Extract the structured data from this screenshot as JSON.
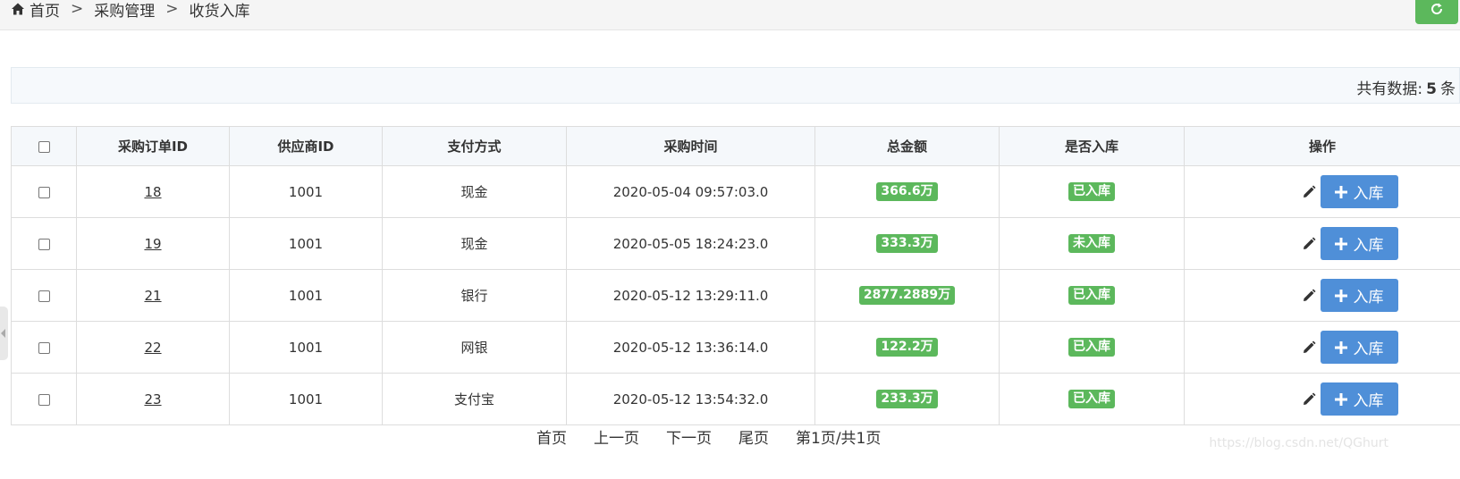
{
  "breadcrumb": {
    "icon": "home-icon",
    "items": [
      "首页",
      "采购管理",
      "收货入库"
    ],
    "separator": ">"
  },
  "toolbar": {
    "refresh_icon": "refresh-icon",
    "refresh_color": "#5cb85c"
  },
  "summary": {
    "label": "共有数据:",
    "count": "5",
    "unit": "条"
  },
  "table": {
    "headers": [
      "采购订单ID",
      "供应商ID",
      "支付方式",
      "采购时间",
      "总金额",
      "是否入库",
      "操作"
    ],
    "rows": [
      {
        "id": "18",
        "supplier": "1001",
        "payment": "现金",
        "time": "2020-05-04 09:57:03.0",
        "amount": "366.6万",
        "status": "已入库",
        "action": "入库"
      },
      {
        "id": "19",
        "supplier": "1001",
        "payment": "现金",
        "time": "2020-05-05 18:24:23.0",
        "amount": "333.3万",
        "status": "未入库",
        "action": "入库"
      },
      {
        "id": "21",
        "supplier": "1001",
        "payment": "银行",
        "time": "2020-05-12 13:29:11.0",
        "amount": "2877.2889万",
        "status": "已入库",
        "action": "入库"
      },
      {
        "id": "22",
        "supplier": "1001",
        "payment": "网银",
        "time": "2020-05-12 13:36:14.0",
        "amount": "122.2万",
        "status": "已入库",
        "action": "入库"
      },
      {
        "id": "23",
        "supplier": "1001",
        "payment": "支付宝",
        "time": "2020-05-12 13:54:32.0",
        "amount": "233.3万",
        "status": "已入库",
        "action": "入库"
      }
    ]
  },
  "pager": {
    "first": "首页",
    "prev": "上一页",
    "next": "下一页",
    "last": "尾页",
    "info": "第1页/共1页"
  },
  "watermark": "https://blog.csdn.net/QGhurt",
  "colors": {
    "badge": "#5cb85c",
    "button": "#4f8fd8"
  }
}
